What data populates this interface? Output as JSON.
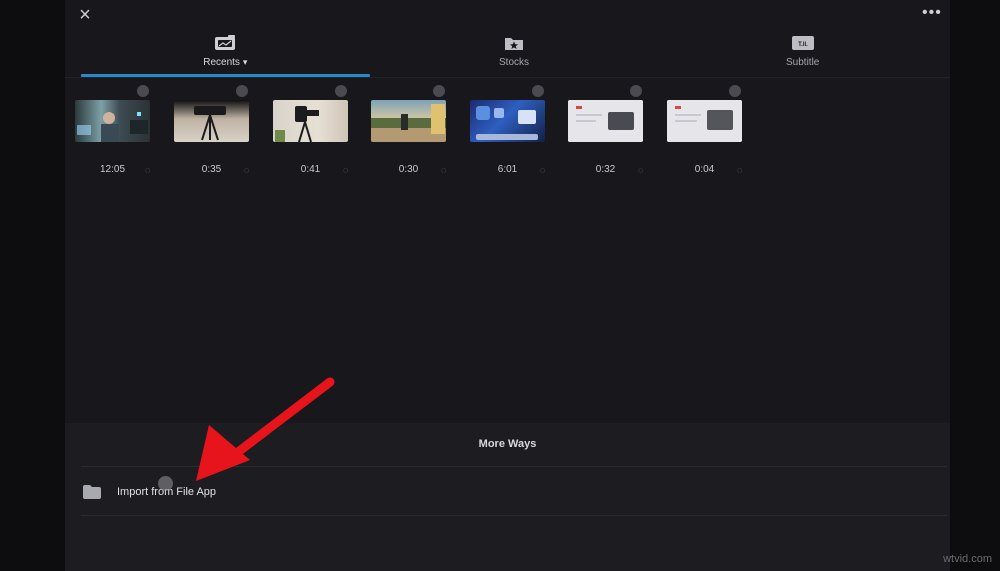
{
  "tabs": [
    {
      "label": "Recents",
      "icon": "recents-icon",
      "active": true
    },
    {
      "label": "Stocks",
      "icon": "stocks-icon",
      "active": false
    },
    {
      "label": "Subtitle",
      "icon": "subtitle-icon",
      "active": false
    }
  ],
  "clips": [
    {
      "duration": "12:05"
    },
    {
      "duration": "0:35"
    },
    {
      "duration": "0:41"
    },
    {
      "duration": "0:30"
    },
    {
      "duration": "6:01"
    },
    {
      "duration": "0:32"
    },
    {
      "duration": "0:04"
    }
  ],
  "more_ways": {
    "title": "More Ways",
    "import_label": "Import from File App"
  },
  "icons": {
    "close": "×",
    "more": "•••",
    "chevron": "⌄",
    "sync": "◌"
  },
  "colors": {
    "accent": "#2a87c9",
    "arrow": "#e8141b"
  },
  "watermark": "wtvid.com"
}
